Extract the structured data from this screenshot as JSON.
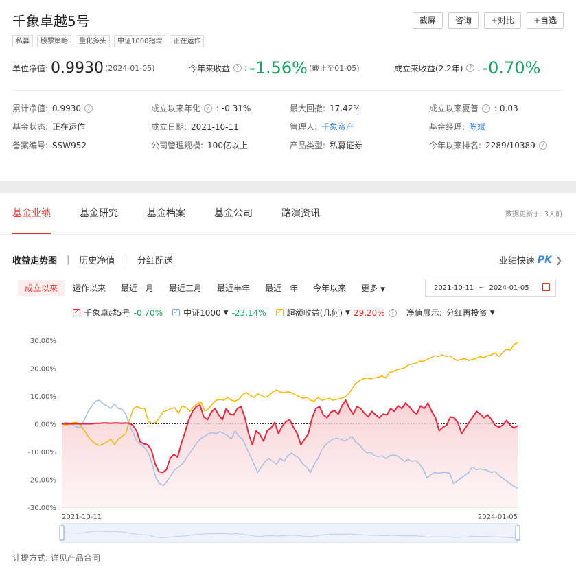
{
  "fund": {
    "name": "千象卓越5号",
    "tags": [
      "私募",
      "股票策略",
      "量化多头",
      "中证1000指增",
      "正在运作"
    ],
    "actions": [
      "截屏",
      "咨询",
      "+对比",
      "+自选"
    ]
  },
  "nav": {
    "unit_label": "单位净值:",
    "unit_value": "0.9930",
    "unit_date": "(2024-01-05)",
    "ytd_label": "今年来收益",
    "ytd_value": "-1.56%",
    "ytd_note": "(截止至01-05)",
    "since_label": "成立来收益(2.2年)",
    "since_value": "-0.70%"
  },
  "info": {
    "cum_nav_label": "累计净值:",
    "cum_nav_value": "0.9930",
    "annualized_label": "成立以来年化",
    "annualized_value": ": -0.31%",
    "max_dd_label": "最大回撤:",
    "max_dd_value": "17.42%",
    "sharpe_label": "成立以来夏普",
    "sharpe_value": ": 0.03",
    "status_label": "基金状态:",
    "status_value": "正在运作",
    "inception_label": "成立日期:",
    "inception_value": "2021-10-11",
    "manager_label": "管理人:",
    "manager_value": "千象资产",
    "pm_label": "基金经理:",
    "pm_value": "陈斌",
    "record_label": "备案编号:",
    "record_value": "SSW952",
    "scale_label": "公司管理规模:",
    "scale_value": "100亿以上",
    "product_label": "产品类型:",
    "product_value": "私募证券",
    "rank_label": "今年以来排名:",
    "rank_value": "2289/10389"
  },
  "tabs": [
    "基金业绩",
    "基金研究",
    "基金档案",
    "基金公司",
    "路演资讯"
  ],
  "update_note": "数据更新于: 3天前",
  "sub_tabs": [
    "收益走势图",
    "历史净值",
    "分红配送"
  ],
  "pk_link": "业绩快速",
  "pk_badge": "PK",
  "ranges": [
    "成立以来",
    "运作以来",
    "最近一月",
    "最近三月",
    "最近半年",
    "最近一年",
    "今年以来",
    "更多"
  ],
  "date_range": {
    "start": "2021-10-11",
    "end": "2024-01-05"
  },
  "legend": {
    "fund_name": "千象卓越5号",
    "fund_value": "-0.70%",
    "index_name": "中证1000",
    "index_value": "-23.14%",
    "excess_name": "超额收益(几何)",
    "excess_value": "29.20%",
    "nav_display_label": "净值展示:",
    "nav_display_value": "分红再投资"
  },
  "colors": {
    "fund": "#e8253a",
    "index": "#a8bde6",
    "excess": "#f2b800",
    "accent": "#e0322f",
    "up_green": "#19a15f",
    "link": "#3a84d6"
  },
  "footer_note": "计提方式: 详见产品合同",
  "chart_data": {
    "type": "line",
    "ylim": [
      -30,
      30
    ],
    "y_ticks": [
      "30.00%",
      "20.00%",
      "10.00%",
      "0.00%",
      "-10.00%",
      "-20.00%",
      "-30.00%"
    ],
    "x_tick_labels": [
      "2021-10-11",
      "2024-01-05"
    ],
    "series": [
      {
        "name": "千象卓越5号",
        "values": [
          0,
          0,
          0,
          0,
          0,
          0,
          0,
          0,
          0,
          0.2,
          0.2,
          0.3,
          0.3,
          0.2,
          0.3,
          0.3,
          0.2,
          0.3,
          0.2,
          -0.5,
          -2.5,
          -6.5,
          -7.2,
          -7.5,
          -9.5,
          -14.5,
          -17.2,
          -17.5,
          -16.5,
          -12.5,
          -11,
          -12,
          -7,
          -3,
          1.5,
          4.5,
          6.2,
          6.8,
          2.5,
          1.5,
          4.2,
          5.5,
          3.2,
          1.5,
          5.5,
          3.5,
          3.2,
          5.5,
          6.2,
          2.2,
          -3.5,
          -7.5,
          -2.5,
          -3.8,
          -6.2,
          -2.5,
          -1.5,
          0.5,
          -3.5,
          -0.8,
          0.8,
          1.5,
          -1.2,
          -3.5,
          -7.5,
          -5.5,
          -3.5,
          2.2,
          5.5,
          6.2,
          3.2,
          2.2,
          4.2,
          4.8,
          3.5,
          6.5,
          8.5,
          5.5,
          3.5,
          6.2,
          5.5,
          3.8,
          2.5,
          4.5,
          3.2,
          2.2,
          3.5,
          3.2,
          5.5,
          4.5,
          6.5,
          5.5,
          7.5,
          6.2,
          4.5,
          3.5,
          6.5,
          5.5,
          7.5,
          4.5,
          2.2,
          -2.5,
          -1.2,
          -0.5,
          2.5,
          2.2,
          0.5,
          -3.5,
          -1.5,
          0.5,
          2.5,
          4.5,
          3.5,
          2.2,
          3.2,
          1.5,
          -0.5,
          -1.2,
          -0.5,
          1.2,
          -0.5,
          -1.5,
          -0.7
        ]
      },
      {
        "name": "中证1000",
        "values": [
          0,
          0.5,
          0.3,
          -0.5,
          -1.2,
          -1.2,
          1.5,
          4.5,
          6.5,
          8.2,
          8.5,
          7.2,
          6.5,
          5.5,
          7.2,
          5.5,
          5.2,
          3.5,
          -0.5,
          -3.5,
          -6.5,
          -7.5,
          -8.5,
          -10.5,
          -14.5,
          -19.5,
          -21.5,
          -22.2,
          -20.5,
          -18.5,
          -16.5,
          -15.5,
          -14.5,
          -12.5,
          -10.5,
          -8.5,
          -6.5,
          -5.2,
          -4.5,
          -3.5,
          -3.2,
          -3.5,
          -2.8,
          -3.5,
          -4.2,
          -5.5,
          -2.5,
          -4.5,
          -5.5,
          -8.5,
          -11.5,
          -14.5,
          -17.5,
          -15.5,
          -13.5,
          -12.5,
          -13.5,
          -14.5,
          -12.5,
          -13.5,
          -11.5,
          -10.5,
          -11.5,
          -12.5,
          -14.5,
          -15.5,
          -17.5,
          -14.5,
          -12.5,
          -9.5,
          -7.5,
          -6.5,
          -5.5,
          -5.2,
          -5.5,
          -6.2,
          -5.5,
          -4.5,
          -6.5,
          -7.5,
          -9.2,
          -10.5,
          -10.2,
          -11.5,
          -11.8,
          -11.5,
          -12.5,
          -11.5,
          -11.2,
          -11.5,
          -12.5,
          -13.5,
          -12.8,
          -13.5,
          -13.2,
          -14.5,
          -16.5,
          -19.5,
          -18.2,
          -17.5,
          -17.8,
          -17.5,
          -17.5,
          -17.8,
          -21.5,
          -20.5,
          -19.5,
          -18.5,
          -17.5,
          -15.5,
          -16.5,
          -16.2,
          -16.5,
          -16.8,
          -17.5,
          -17.2,
          -18.5,
          -19.5,
          -20.5,
          -21.5,
          -22.5,
          -23.14
        ]
      },
      {
        "name": "超额收益(几何)",
        "values": [
          0,
          -0.5,
          -0.2,
          0.5,
          0.5,
          -0.5,
          -2.5,
          -4.5,
          -6.2,
          -7.2,
          -7.8,
          -7.2,
          -6.5,
          -5.5,
          -7.5,
          -5.5,
          -4.5,
          -3.5,
          1.5,
          5.5,
          6.2,
          5.5,
          5.5,
          0.8,
          0.2,
          0.5,
          2.5,
          4.5,
          4.8,
          5.5,
          5.8,
          3.8,
          6.5,
          5.8,
          4.5,
          6.2,
          7.2,
          7.8,
          4.5,
          5.5,
          7.2,
          8.5,
          8.8,
          8.5,
          9.5,
          8.5,
          8.2,
          8.8,
          10.5,
          11.2,
          10.2,
          9.5,
          10.8,
          10.2,
          9.5,
          10.2,
          11.5,
          12.2,
          11.5,
          11.2,
          11.5,
          11.2,
          10.5,
          9.8,
          9.2,
          9.5,
          8.5,
          8.2,
          9.5,
          8.5,
          8.8,
          9.2,
          8.5,
          8.8,
          9.2,
          9.5,
          10.5,
          12.5,
          14.5,
          15.5,
          16.2,
          16.5,
          16.2,
          16.5,
          16.8,
          17.2,
          16.5,
          18.5,
          18.8,
          19.5,
          19.8,
          20.2,
          21.2,
          21.5,
          21.8,
          22.5,
          22.5,
          23.2,
          23.8,
          24.5,
          24.2,
          24.8,
          24.2,
          24.5,
          23.5,
          22.8,
          23.2,
          23.5,
          22.8,
          23.2,
          23.5,
          24.2,
          23.8,
          24.5,
          24.8,
          25.5,
          24.2,
          25.5,
          26.8,
          26.5,
          28.5,
          29.2
        ]
      }
    ]
  }
}
